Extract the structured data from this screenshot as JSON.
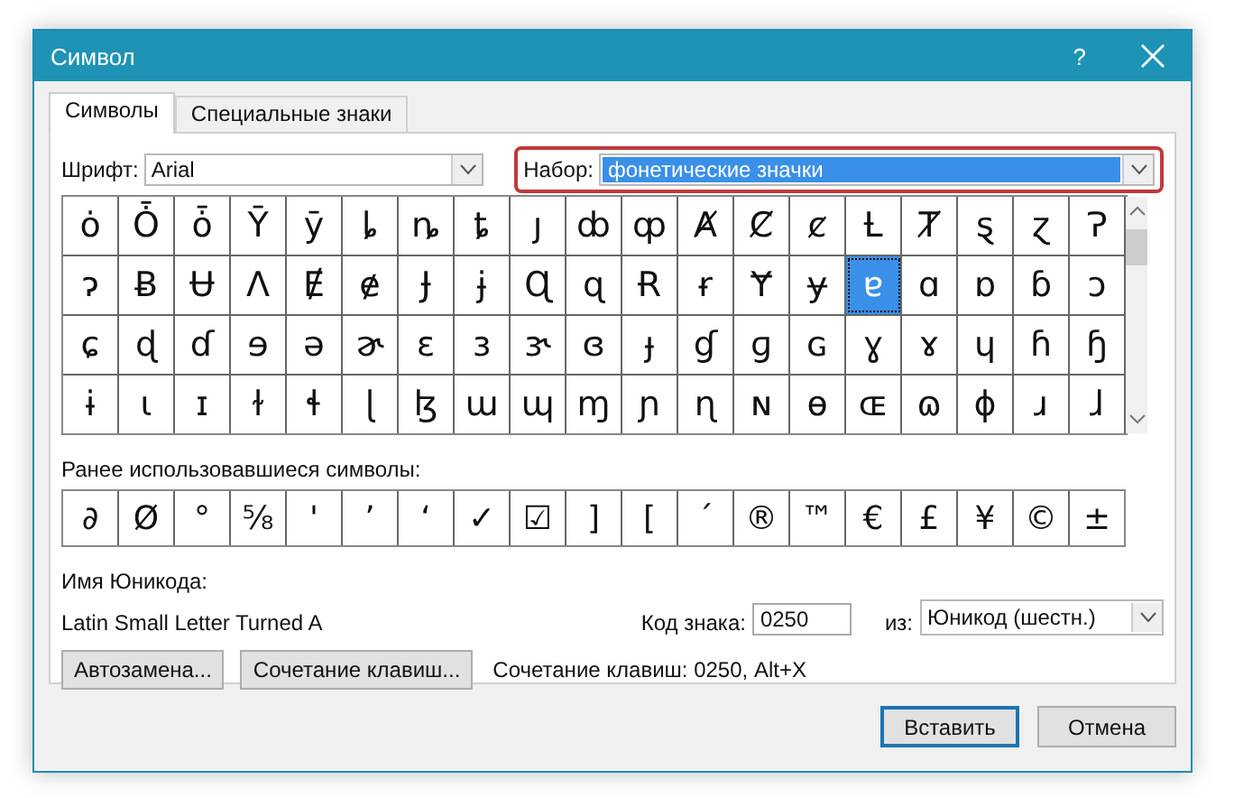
{
  "window": {
    "title": "Символ",
    "help": "?"
  },
  "tabs": [
    {
      "label": "Символы",
      "selected": true
    },
    {
      "label": "Специальные знаки",
      "selected": false
    }
  ],
  "font": {
    "label": "Шрифт:",
    "value": "Arial"
  },
  "subset": {
    "label": "Набор:",
    "value": "фонетические значки",
    "highlighted": true
  },
  "grid": [
    [
      {
        "c": "ȯ",
        "selected": false
      },
      {
        "c": "Ȱ",
        "selected": false
      },
      {
        "c": "ȱ",
        "selected": false
      },
      {
        "c": "Ȳ",
        "selected": false
      },
      {
        "c": "ȳ",
        "selected": false
      },
      {
        "c": "ȴ",
        "selected": false
      },
      {
        "c": "ȵ",
        "selected": false
      },
      {
        "c": "ȶ",
        "selected": false
      },
      {
        "c": "ȷ",
        "selected": false
      },
      {
        "c": "ȸ",
        "selected": false
      },
      {
        "c": "ȹ",
        "selected": false
      },
      {
        "c": "Ⱥ",
        "selected": false
      },
      {
        "c": "Ȼ",
        "selected": false
      },
      {
        "c": "ȼ",
        "selected": false
      },
      {
        "c": "Ƚ",
        "selected": false
      },
      {
        "c": "Ⱦ",
        "selected": false
      },
      {
        "c": "ȿ",
        "selected": false
      },
      {
        "c": "ɀ",
        "selected": false
      },
      {
        "c": "Ɂ",
        "selected": false
      }
    ],
    [
      {
        "c": "ɂ",
        "selected": false
      },
      {
        "c": "Ƀ",
        "selected": false
      },
      {
        "c": "Ʉ",
        "selected": false
      },
      {
        "c": "Ʌ",
        "selected": false
      },
      {
        "c": "Ɇ",
        "selected": false
      },
      {
        "c": "ɇ",
        "selected": false
      },
      {
        "c": "Ɉ",
        "selected": false
      },
      {
        "c": "ɉ",
        "selected": false
      },
      {
        "c": "Ɋ",
        "selected": false
      },
      {
        "c": "ɋ",
        "selected": false
      },
      {
        "c": "Ɍ",
        "selected": false
      },
      {
        "c": "ɍ",
        "selected": false
      },
      {
        "c": "Ɏ",
        "selected": false
      },
      {
        "c": "ɏ",
        "selected": false
      },
      {
        "c": "ɐ",
        "selected": true
      },
      {
        "c": "ɑ",
        "selected": false
      },
      {
        "c": "ɒ",
        "selected": false
      },
      {
        "c": "ɓ",
        "selected": false
      },
      {
        "c": "ɔ",
        "selected": false
      }
    ],
    [
      {
        "c": "ɕ",
        "selected": false
      },
      {
        "c": "ɖ",
        "selected": false
      },
      {
        "c": "ɗ",
        "selected": false
      },
      {
        "c": "ɘ",
        "selected": false
      },
      {
        "c": "ə",
        "selected": false
      },
      {
        "c": "ɚ",
        "selected": false
      },
      {
        "c": "ɛ",
        "selected": false
      },
      {
        "c": "ɜ",
        "selected": false
      },
      {
        "c": "ɝ",
        "selected": false
      },
      {
        "c": "ɞ",
        "selected": false
      },
      {
        "c": "ɟ",
        "selected": false
      },
      {
        "c": "ɠ",
        "selected": false
      },
      {
        "c": "ɡ",
        "selected": false
      },
      {
        "c": "ɢ",
        "selected": false
      },
      {
        "c": "ɣ",
        "selected": false
      },
      {
        "c": "ɤ",
        "selected": false
      },
      {
        "c": "ɥ",
        "selected": false
      },
      {
        "c": "ɦ",
        "selected": false
      },
      {
        "c": "ɧ",
        "selected": false
      }
    ],
    [
      {
        "c": "ɨ",
        "selected": false
      },
      {
        "c": "ɩ",
        "selected": false
      },
      {
        "c": "ɪ",
        "selected": false
      },
      {
        "c": "ɫ",
        "selected": false
      },
      {
        "c": "ɬ",
        "selected": false
      },
      {
        "c": "ɭ",
        "selected": false
      },
      {
        "c": "ɮ",
        "selected": false
      },
      {
        "c": "ɯ",
        "selected": false
      },
      {
        "c": "ɰ",
        "selected": false
      },
      {
        "c": "ɱ",
        "selected": false
      },
      {
        "c": "ɲ",
        "selected": false
      },
      {
        "c": "ɳ",
        "selected": false
      },
      {
        "c": "ɴ",
        "selected": false
      },
      {
        "c": "ɵ",
        "selected": false
      },
      {
        "c": "ɶ",
        "selected": false
      },
      {
        "c": "ɷ",
        "selected": false
      },
      {
        "c": "ɸ",
        "selected": false
      },
      {
        "c": "ɹ",
        "selected": false
      },
      {
        "c": "ɺ",
        "selected": false
      }
    ]
  ],
  "recent": {
    "label": "Ранее использовавшиеся символы:",
    "symbols": [
      "∂",
      "Ø",
      "°",
      "⅝",
      "'",
      "’",
      "‘",
      "✓",
      "☑",
      "]",
      "[",
      "´",
      "®",
      "™",
      "€",
      "£",
      "¥",
      "©",
      "±"
    ]
  },
  "unicode_name": {
    "label": "Имя Юникода:",
    "value": "Latin Small Letter Turned A"
  },
  "code": {
    "label": "Код знака:",
    "value": "0250"
  },
  "from": {
    "label": "из:",
    "value": "Юникод (шестн.)"
  },
  "buttons": [
    {
      "label": "Автозамена..."
    },
    {
      "label": "Сочетание клавиш..."
    }
  ],
  "shortcut_text": "Сочетание клавиш: 0250, Alt+X",
  "footer": [
    {
      "label": "Вставить",
      "default": true
    },
    {
      "label": "Отмена",
      "default": false
    }
  ]
}
